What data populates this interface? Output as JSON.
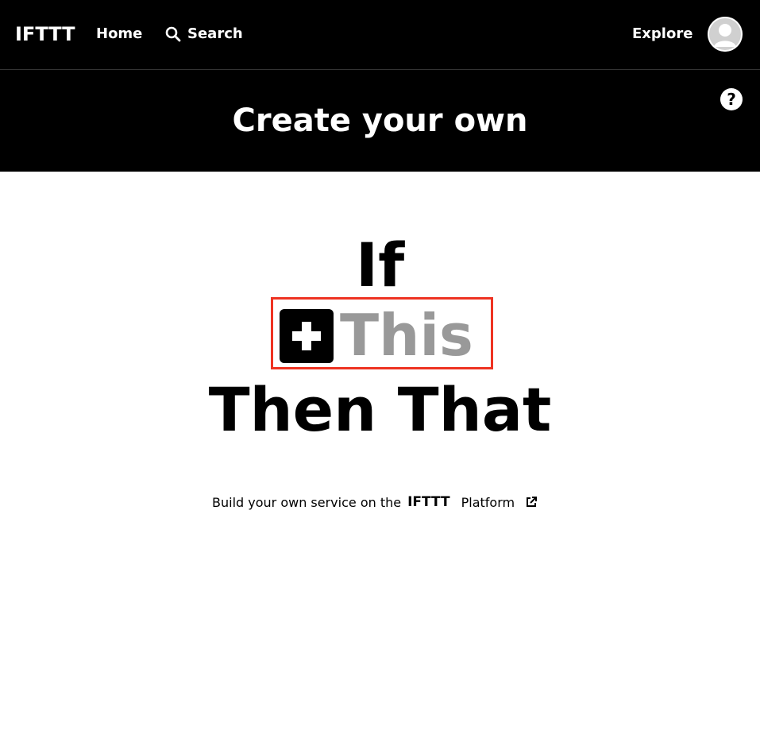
{
  "nav": {
    "logo": "IFTTT",
    "home_label": "Home",
    "search_label": "Search",
    "explore_label": "Explore",
    "avatar_icon": "user-avatar-icon"
  },
  "hero": {
    "title": "Create your own",
    "help_symbol": "?"
  },
  "builder": {
    "if_word": "If",
    "this_word": "This",
    "then_that": "Then That",
    "highlight_color": "#ee3322",
    "this_color": "#999999"
  },
  "footer": {
    "platform_prefix": "Build your own service on the",
    "platform_brand": "IFTTT",
    "platform_label": "Platform",
    "external_icon": "external-link-icon"
  }
}
